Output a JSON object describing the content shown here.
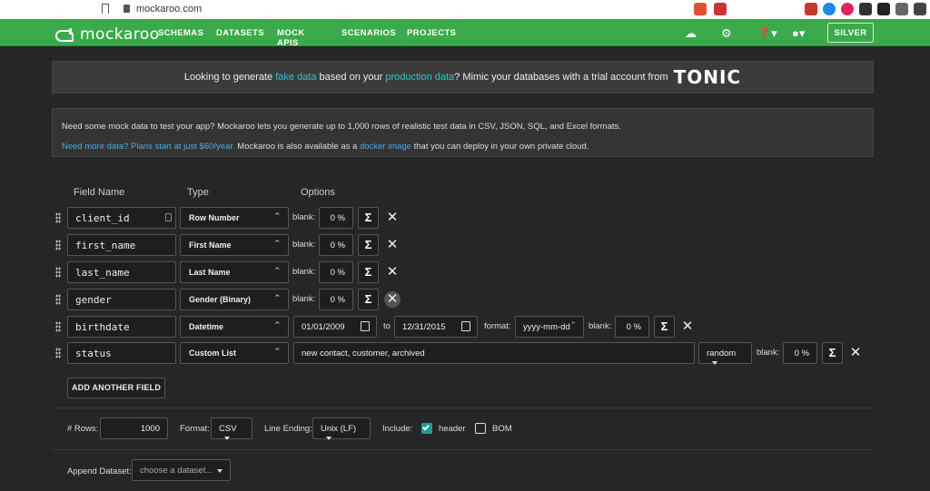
{
  "browser": {
    "url": "mockaroo.com"
  },
  "nav": {
    "brand": "mockaroo",
    "menu": [
      "SCHEMAS",
      "DATASETS",
      "MOCK APIS",
      "SCENARIOS",
      "PROJECTS"
    ],
    "plan_button": "SILVER",
    "icons": [
      "cloud-upload-icon",
      "gear-icon",
      "help-icon",
      "user-icon"
    ]
  },
  "tonic_banner": {
    "text1": "Looking to generate ",
    "hl1": "fake data",
    "text2": " based on your ",
    "hl2": "production data",
    "text3": "? Mimic your databases with a trial account from",
    "brand": "TONIC"
  },
  "intro": {
    "line1": "Need some mock data to test your app? Mockaroo lets you generate up to 1,000 rows of realistic test data in CSV, JSON, SQL, and Excel formats.",
    "line2_link": "Need more data? Plans start at just $60/year.",
    "line2_mid": " Mockaroo is also available as a ",
    "line2_link2": "docker image",
    "line2_end": " that you can deploy in your own private cloud."
  },
  "table": {
    "headers": {
      "name": "Field Name",
      "type": "Type",
      "options": "Options"
    },
    "blank_label": "blank:",
    "blank_value": "0 %",
    "fields": [
      {
        "name": "client_id",
        "type": "Row Number"
      },
      {
        "name": "first_name",
        "type": "First Name"
      },
      {
        "name": "last_name",
        "type": "Last Name"
      },
      {
        "name": "gender",
        "type": "Gender (Binary)"
      },
      {
        "name": "birthdate",
        "type": "Datetime",
        "from": "01/01/2009",
        "to_label": "to",
        "to": "12/31/2015",
        "format_label": "format:",
        "format": "yyyy-mm-dd"
      },
      {
        "name": "status",
        "type": "Custom List",
        "values": "new contact, customer, archived",
        "order": "random"
      }
    ],
    "add_button": "ADD ANOTHER FIELD"
  },
  "options": {
    "rows_label": "# Rows:",
    "rows_value": "1000",
    "format_label": "Format:",
    "format_value": "CSV",
    "line_ending_label": "Line Ending:",
    "line_ending_value": "Unix (LF)",
    "include_label": "Include:",
    "header_label": "header",
    "bom_label": "BOM",
    "append_label": "Append Dataset:",
    "append_placeholder": "choose a dataset..."
  },
  "colors": {
    "nav": "#3aaa4a",
    "accent": "#2ec4cc",
    "link": "#4ea9e6",
    "checkbox": "#1f9f94"
  }
}
